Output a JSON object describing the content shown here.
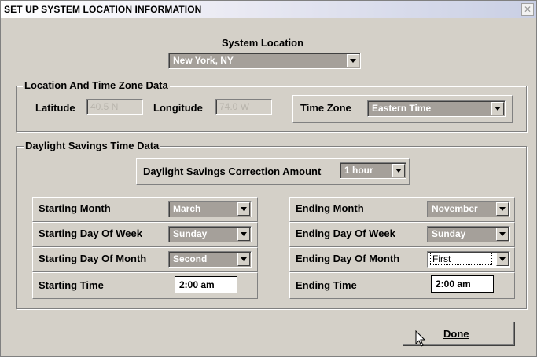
{
  "window": {
    "title": "SET UP SYSTEM LOCATION INFORMATION",
    "close_symbol": "✕"
  },
  "system_location": {
    "label": "System Location",
    "value": "New York, NY"
  },
  "location_group": {
    "label": "Location And Time Zone Data",
    "latitude_label": "Latitude",
    "latitude_value": "40.5 N",
    "longitude_label": "Longitude",
    "longitude_value": "74.0 W",
    "timezone_label": "Time Zone",
    "timezone_value": "Eastern Time"
  },
  "dst_group": {
    "label": "Daylight Savings Time Data",
    "correction_label": "Daylight Savings Correction Amount",
    "correction_value": "1 hour",
    "start": {
      "month_label": "Starting Month",
      "month_value": "March",
      "dow_label": "Starting Day Of Week",
      "dow_value": "Sunday",
      "dom_label": "Starting Day Of Month",
      "dom_value": "Second",
      "time_label": "Starting Time",
      "time_value": "2:00 am"
    },
    "end": {
      "month_label": "Ending Month",
      "month_value": "November",
      "dow_label": "Ending Day Of Week",
      "dow_value": "Sunday",
      "dom_label": "Ending Day Of Month",
      "dom_value": "First",
      "time_label": "Ending Time",
      "time_value": "2:00 am"
    }
  },
  "done_button": {
    "label": "Done"
  },
  "icons": {
    "cursor": "arrow-cursor-icon",
    "dropdown": "chevron-down-icon",
    "close": "close-icon"
  }
}
